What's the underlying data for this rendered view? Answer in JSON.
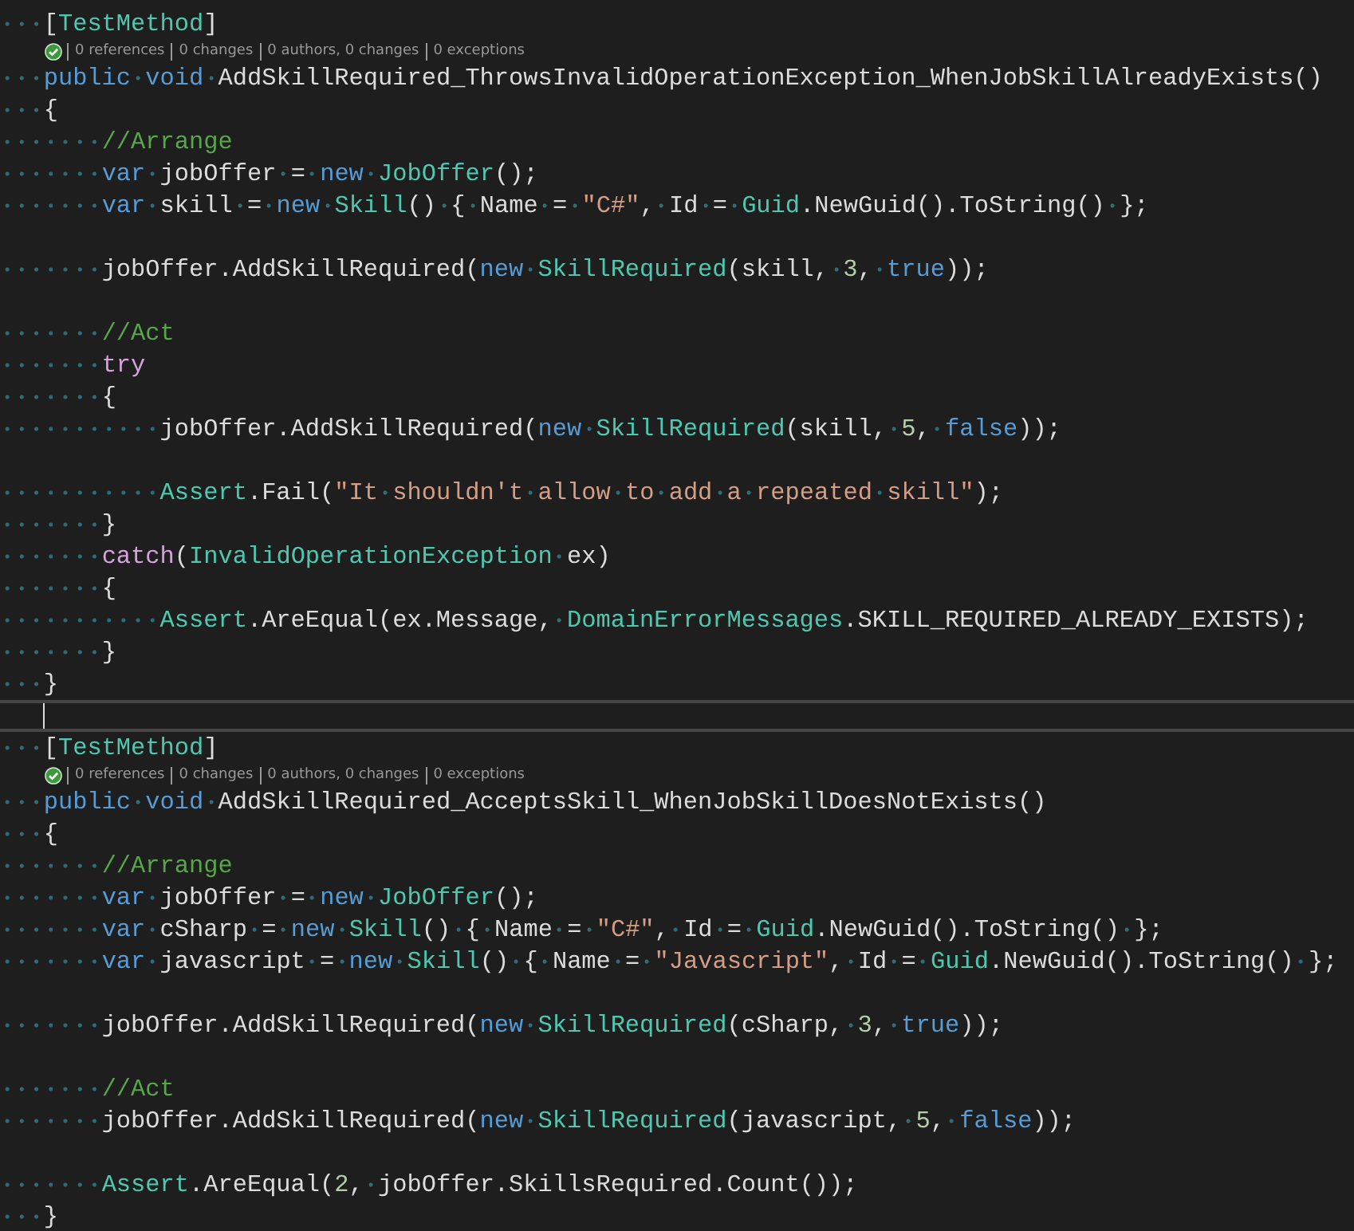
{
  "editor": {
    "lines": [
      {
        "kind": "code",
        "tokens": [
          {
            "text": "   [",
            "kind": "plain"
          },
          {
            "text": "TestMethod",
            "kind": "type"
          },
          {
            "text": "]",
            "kind": "plain"
          }
        ]
      },
      {
        "kind": "codelens",
        "passed": true,
        "items": [
          "0 references",
          "0 changes",
          "0 authors, 0 changes",
          "0 exceptions"
        ]
      },
      {
        "kind": "code",
        "tokens": [
          {
            "text": "   public void",
            "kind": "keyword"
          },
          {
            "text": " AddSkillRequired_ThrowsInvalidOperationException_WhenJobSkillAlreadyExists()",
            "kind": "plain"
          }
        ]
      },
      {
        "kind": "code",
        "tokens": [
          {
            "text": "   {",
            "kind": "plain"
          }
        ]
      },
      {
        "kind": "code",
        "tokens": [
          {
            "text": "       //Arrange",
            "kind": "comment"
          }
        ]
      },
      {
        "kind": "code",
        "tokens": [
          {
            "text": "       var",
            "kind": "keyword"
          },
          {
            "text": " jobOffer = ",
            "kind": "plain"
          },
          {
            "text": "new ",
            "kind": "keyword"
          },
          {
            "text": "JobOffer",
            "kind": "type"
          },
          {
            "text": "();",
            "kind": "plain"
          }
        ]
      },
      {
        "kind": "code",
        "tokens": [
          {
            "text": "       var",
            "kind": "keyword"
          },
          {
            "text": " skill = ",
            "kind": "plain"
          },
          {
            "text": "new ",
            "kind": "keyword"
          },
          {
            "text": "Skill",
            "kind": "type"
          },
          {
            "text": "() { Name = ",
            "kind": "plain"
          },
          {
            "text": "\"C#\"",
            "kind": "string"
          },
          {
            "text": ", Id = ",
            "kind": "plain"
          },
          {
            "text": "Guid",
            "kind": "type"
          },
          {
            "text": ".NewGuid().ToString() };",
            "kind": "plain"
          }
        ]
      },
      {
        "kind": "blank"
      },
      {
        "kind": "code",
        "tokens": [
          {
            "text": "       jobOffer.AddSkillRequired(",
            "kind": "plain"
          },
          {
            "text": "new ",
            "kind": "keyword"
          },
          {
            "text": "SkillRequired",
            "kind": "type"
          },
          {
            "text": "(skill, ",
            "kind": "plain"
          },
          {
            "text": "3",
            "kind": "number"
          },
          {
            "text": ", ",
            "kind": "plain"
          },
          {
            "text": "true",
            "kind": "keyword"
          },
          {
            "text": "));",
            "kind": "plain"
          }
        ]
      },
      {
        "kind": "blank"
      },
      {
        "kind": "code",
        "tokens": [
          {
            "text": "       //Act",
            "kind": "comment"
          }
        ]
      },
      {
        "kind": "code",
        "tokens": [
          {
            "text": "       try",
            "kind": "control"
          }
        ]
      },
      {
        "kind": "code",
        "tokens": [
          {
            "text": "       {",
            "kind": "plain"
          }
        ]
      },
      {
        "kind": "code",
        "tokens": [
          {
            "text": "           jobOffer.AddSkillRequired(",
            "kind": "plain"
          },
          {
            "text": "new ",
            "kind": "keyword"
          },
          {
            "text": "SkillRequired",
            "kind": "type"
          },
          {
            "text": "(skill, ",
            "kind": "plain"
          },
          {
            "text": "5",
            "kind": "number"
          },
          {
            "text": ", ",
            "kind": "plain"
          },
          {
            "text": "false",
            "kind": "keyword"
          },
          {
            "text": "));",
            "kind": "plain"
          }
        ]
      },
      {
        "kind": "blank"
      },
      {
        "kind": "code",
        "tokens": [
          {
            "text": "           Assert",
            "kind": "type"
          },
          {
            "text": ".Fail(",
            "kind": "plain"
          },
          {
            "text": "\"It shouldn't allow to add a repeated skill\"",
            "kind": "string"
          },
          {
            "text": ");",
            "kind": "plain"
          }
        ]
      },
      {
        "kind": "code",
        "tokens": [
          {
            "text": "       }",
            "kind": "plain"
          }
        ]
      },
      {
        "kind": "code",
        "tokens": [
          {
            "text": "       catch",
            "kind": "control"
          },
          {
            "text": "(",
            "kind": "plain"
          },
          {
            "text": "InvalidOperationException",
            "kind": "type"
          },
          {
            "text": " ex)",
            "kind": "plain"
          }
        ]
      },
      {
        "kind": "code",
        "tokens": [
          {
            "text": "       {",
            "kind": "plain"
          }
        ]
      },
      {
        "kind": "code",
        "tokens": [
          {
            "text": "           Assert",
            "kind": "type"
          },
          {
            "text": ".AreEqual(ex.Message, ",
            "kind": "plain"
          },
          {
            "text": "DomainErrorMessages",
            "kind": "type"
          },
          {
            "text": ".SKILL_REQUIRED_ALREADY_EXISTS);",
            "kind": "plain"
          }
        ]
      },
      {
        "kind": "code",
        "tokens": [
          {
            "text": "       }",
            "kind": "plain"
          }
        ]
      },
      {
        "kind": "code",
        "tokens": [
          {
            "text": "   }",
            "kind": "plain"
          }
        ]
      },
      {
        "kind": "current"
      },
      {
        "kind": "code",
        "tokens": [
          {
            "text": "   [",
            "kind": "plain"
          },
          {
            "text": "TestMethod",
            "kind": "type"
          },
          {
            "text": "]",
            "kind": "plain"
          }
        ]
      },
      {
        "kind": "codelens",
        "passed": true,
        "items": [
          "0 references",
          "0 changes",
          "0 authors, 0 changes",
          "0 exceptions"
        ]
      },
      {
        "kind": "code",
        "tokens": [
          {
            "text": "   public void",
            "kind": "keyword"
          },
          {
            "text": " AddSkillRequired_AcceptsSkill_WhenJobSkillDoesNotExists()",
            "kind": "plain"
          }
        ]
      },
      {
        "kind": "code",
        "tokens": [
          {
            "text": "   {",
            "kind": "plain"
          }
        ]
      },
      {
        "kind": "code",
        "tokens": [
          {
            "text": "       //Arrange",
            "kind": "comment"
          }
        ]
      },
      {
        "kind": "code",
        "tokens": [
          {
            "text": "       var",
            "kind": "keyword"
          },
          {
            "text": " jobOffer = ",
            "kind": "plain"
          },
          {
            "text": "new ",
            "kind": "keyword"
          },
          {
            "text": "JobOffer",
            "kind": "type"
          },
          {
            "text": "();",
            "kind": "plain"
          }
        ]
      },
      {
        "kind": "code",
        "tokens": [
          {
            "text": "       var",
            "kind": "keyword"
          },
          {
            "text": " cSharp = ",
            "kind": "plain"
          },
          {
            "text": "new ",
            "kind": "keyword"
          },
          {
            "text": "Skill",
            "kind": "type"
          },
          {
            "text": "() { Name = ",
            "kind": "plain"
          },
          {
            "text": "\"C#\"",
            "kind": "string"
          },
          {
            "text": ", Id = ",
            "kind": "plain"
          },
          {
            "text": "Guid",
            "kind": "type"
          },
          {
            "text": ".NewGuid().ToString() };",
            "kind": "plain"
          }
        ]
      },
      {
        "kind": "code",
        "tokens": [
          {
            "text": "       var",
            "kind": "keyword"
          },
          {
            "text": " javascript = ",
            "kind": "plain"
          },
          {
            "text": "new ",
            "kind": "keyword"
          },
          {
            "text": "Skill",
            "kind": "type"
          },
          {
            "text": "() { Name = ",
            "kind": "plain"
          },
          {
            "text": "\"Javascript\"",
            "kind": "string"
          },
          {
            "text": ", Id = ",
            "kind": "plain"
          },
          {
            "text": "Guid",
            "kind": "type"
          },
          {
            "text": ".NewGuid().ToString() };",
            "kind": "plain"
          }
        ]
      },
      {
        "kind": "blank"
      },
      {
        "kind": "code",
        "tokens": [
          {
            "text": "       jobOffer.AddSkillRequired(",
            "kind": "plain"
          },
          {
            "text": "new ",
            "kind": "keyword"
          },
          {
            "text": "SkillRequired",
            "kind": "type"
          },
          {
            "text": "(cSharp, ",
            "kind": "plain"
          },
          {
            "text": "3",
            "kind": "number"
          },
          {
            "text": ", ",
            "kind": "plain"
          },
          {
            "text": "true",
            "kind": "keyword"
          },
          {
            "text": "));",
            "kind": "plain"
          }
        ]
      },
      {
        "kind": "blank"
      },
      {
        "kind": "code",
        "tokens": [
          {
            "text": "       //Act",
            "kind": "comment"
          }
        ]
      },
      {
        "kind": "code",
        "tokens": [
          {
            "text": "       jobOffer.AddSkillRequired(",
            "kind": "plain"
          },
          {
            "text": "new ",
            "kind": "keyword"
          },
          {
            "text": "SkillRequired",
            "kind": "type"
          },
          {
            "text": "(javascript, ",
            "kind": "plain"
          },
          {
            "text": "5",
            "kind": "number"
          },
          {
            "text": ", ",
            "kind": "plain"
          },
          {
            "text": "false",
            "kind": "keyword"
          },
          {
            "text": "));",
            "kind": "plain"
          }
        ]
      },
      {
        "kind": "blank"
      },
      {
        "kind": "code",
        "tokens": [
          {
            "text": "       Assert",
            "kind": "type"
          },
          {
            "text": ".AreEqual(",
            "kind": "plain"
          },
          {
            "text": "2",
            "kind": "number"
          },
          {
            "text": ", jobOffer.SkillsRequired.Count());",
            "kind": "plain"
          }
        ]
      },
      {
        "kind": "code",
        "tokens": [
          {
            "text": "   }",
            "kind": "plain"
          }
        ]
      }
    ]
  }
}
